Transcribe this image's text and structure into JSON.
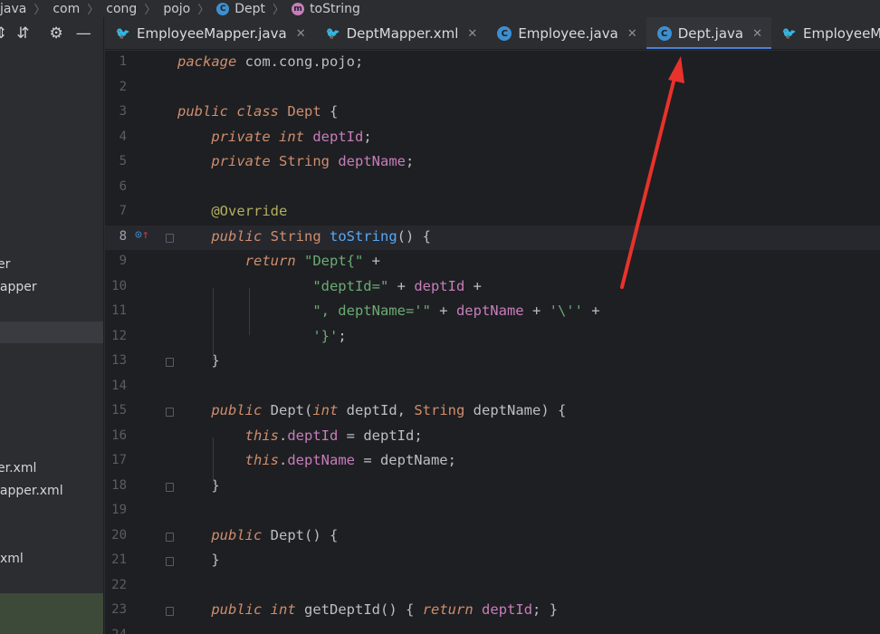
{
  "breadcrumb": {
    "items": [
      "java",
      "com",
      "cong",
      "pojo",
      "Dept",
      "toString"
    ]
  },
  "project": {
    "items": [
      "er",
      "lapper",
      "er.xml",
      "lapper.xml",
      "xml"
    ]
  },
  "tabs": [
    {
      "label": "EmployeeMapper.java",
      "icon": "mapper-bird-icon"
    },
    {
      "label": "DeptMapper.xml",
      "icon": "mapper-bird-icon"
    },
    {
      "label": "Employee.java",
      "icon": "class-icon"
    },
    {
      "label": "Dept.java",
      "icon": "class-icon",
      "active": true
    },
    {
      "label": "EmployeeMapp",
      "icon": "mapper-bird-icon"
    }
  ],
  "lines": [
    {
      "n": "1"
    },
    {
      "n": "2"
    },
    {
      "n": "3"
    },
    {
      "n": "4"
    },
    {
      "n": "5"
    },
    {
      "n": "6"
    },
    {
      "n": "7"
    },
    {
      "n": "8"
    },
    {
      "n": "9"
    },
    {
      "n": "10"
    },
    {
      "n": "11"
    },
    {
      "n": "12"
    },
    {
      "n": "13"
    },
    {
      "n": "14"
    },
    {
      "n": "15"
    },
    {
      "n": "16"
    },
    {
      "n": "17"
    },
    {
      "n": "18"
    },
    {
      "n": "19"
    },
    {
      "n": "20"
    },
    {
      "n": "21"
    },
    {
      "n": "22"
    },
    {
      "n": "23"
    },
    {
      "n": "24"
    }
  ],
  "code": {
    "l1": {
      "kw": "package",
      "rest": " com.cong.pojo;"
    },
    "l3": {
      "kw1": "public",
      "kw2": "class",
      "name": "Dept",
      "rest": " {"
    },
    "l4": {
      "kw1": "private",
      "kw2": "int",
      "field": "deptId",
      "rest": ";"
    },
    "l5": {
      "kw1": "private",
      "type": "String",
      "field": "deptName",
      "rest": ";"
    },
    "l7": {
      "ann": "@Override"
    },
    "l8": {
      "kw1": "public",
      "type": "String",
      "fn": "toString",
      "rest": "() {"
    },
    "l9": {
      "kw": "return",
      "str": "\"Dept{\"",
      "rest": " +"
    },
    "l10": {
      "str": "\"deptId=\"",
      "op": " + ",
      "field": "deptId",
      "rest": " +"
    },
    "l11": {
      "str": "\", deptName='\"",
      "op": " + ",
      "field": "deptName",
      "op2": " + ",
      "str2": "'\\''",
      "rest": " +"
    },
    "l12": {
      "str": "'}'",
      "rest": ";"
    },
    "l13": {
      "rest": "}"
    },
    "l15": {
      "kw1": "public",
      "name": "Dept",
      "p1": "(",
      "kw2": "int",
      "a1": " deptId, ",
      "type": "String",
      "a2": " deptName",
      "rest": ") {"
    },
    "l16": {
      "kw": "this",
      "dot": ".",
      "field": "deptId",
      "rest": " = deptId;"
    },
    "l17": {
      "kw": "this",
      "dot": ".",
      "field": "deptName",
      "rest": " = deptName;"
    },
    "l18": {
      "rest": "}"
    },
    "l20": {
      "kw1": "public",
      "name": "Dept",
      "rest": "() {"
    },
    "l21": {
      "rest": "}"
    },
    "l23": {
      "kw1": "public",
      "kw2": "int",
      "name": "getDeptId",
      "open": "() { ",
      "kw3": "return",
      "field": "deptId",
      "rest": "; }"
    }
  },
  "colors": {
    "keyword": "#cf8e6d",
    "field": "#c77dbb",
    "string": "#6aab73",
    "annotation": "#b3ae60",
    "method": "#56a8f5",
    "accent": "#4c80d6",
    "arrow": "#e8322b"
  }
}
